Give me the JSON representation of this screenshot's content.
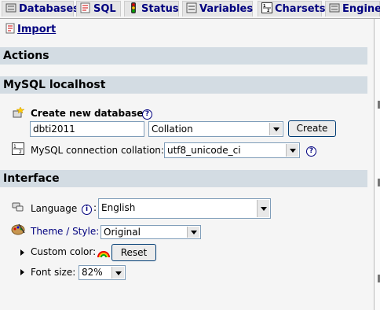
{
  "tabs": [
    {
      "label": "Databases",
      "icon": "databases-icon"
    },
    {
      "label": "SQL",
      "icon": "sql-icon"
    },
    {
      "label": "Status",
      "icon": "status-icon"
    },
    {
      "label": "Variables",
      "icon": "variables-icon"
    },
    {
      "label": "Charsets",
      "icon": "charsets-icon"
    },
    {
      "label": "Engines",
      "icon": "engines-icon"
    }
  ],
  "import_link": "Import",
  "sections": {
    "actions": "Actions",
    "mysql": "MySQL localhost",
    "interface": "Interface"
  },
  "create_db": {
    "label": "Create new database",
    "name_value": "dbti2011",
    "collation_value": "Collation",
    "button": "Create"
  },
  "connection_collation": {
    "label": "MySQL connection collation:",
    "value": "utf8_unicode_ci"
  },
  "interface": {
    "language_label": "Language",
    "language_value": "English",
    "theme_label": "Theme / Style:",
    "theme_value": "Original",
    "custom_color_label": "Custom color:",
    "reset_button": "Reset",
    "font_size_label": "Font size:",
    "font_size_value": "82%"
  },
  "colors": {
    "tab_text": "#00007f",
    "section_bar": "#d3dce3",
    "background": "#f5f5f5"
  }
}
